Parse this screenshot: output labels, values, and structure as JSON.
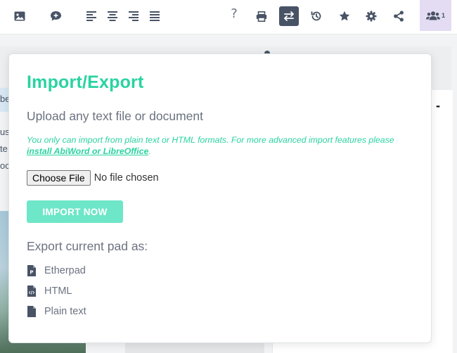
{
  "toolbar": {
    "help_label": "?",
    "users_count": "1",
    "icons": [
      "image-icon",
      "comment-icon",
      "align-left-icon",
      "align-center-icon",
      "align-right-icon",
      "align-justify-icon",
      "help-icon",
      "print-icon",
      "import-export-icon",
      "history-icon",
      "star-icon",
      "settings-icon",
      "share-icon",
      "users-icon"
    ]
  },
  "popup": {
    "title": "Import/Export",
    "upload_heading": "Upload any text file or document",
    "notice_text": "You only can import from plain text or HTML formats. For more advanced import features please ",
    "notice_link": "install AbiWord or LibreOffice",
    "notice_end": ".",
    "choose_file_label": "Choose File",
    "no_file_label": "No file chosen",
    "import_button": "IMPORT NOW",
    "export_heading": "Export current pad as:",
    "export_options": [
      {
        "label": "Etherpad",
        "icon": "etherpad-file-icon"
      },
      {
        "label": "HTML",
        "icon": "html-file-icon"
      },
      {
        "label": "Plain text",
        "icon": "text-file-icon"
      }
    ]
  },
  "background": {
    "left_fragments": [
      "be",
      "us",
      "te",
      "oc"
    ],
    "right_symbol": "-"
  },
  "colors": {
    "accent": "#2ad3a1",
    "import_button_bg": "#6ee6c8",
    "icon": "#485365",
    "active_button": "#485365",
    "users_bg": "#e4dcf3"
  }
}
